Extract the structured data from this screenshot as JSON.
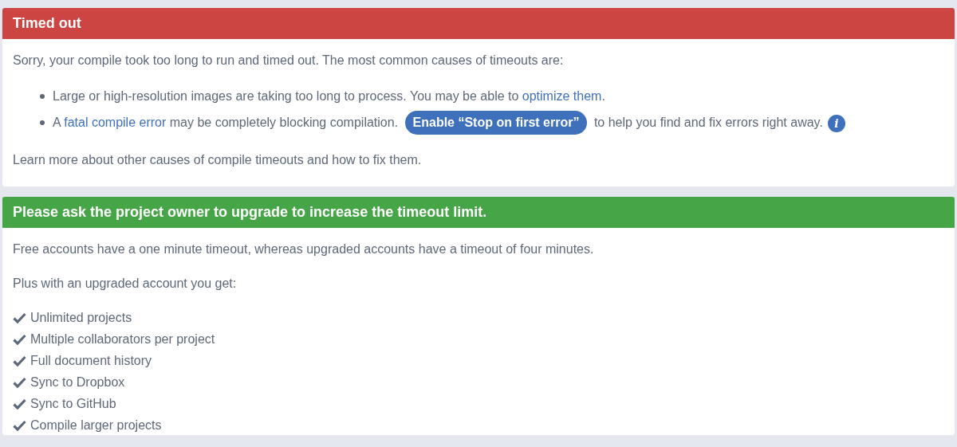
{
  "alerts": [
    {
      "kind": "error",
      "title": "Timed out",
      "blocks": [
        {
          "kind": "paragraph",
          "segments": [
            {
              "kind": "text",
              "text": "Sorry, your compile took too long to run and timed out. The most common causes of timeouts are:"
            }
          ]
        },
        {
          "kind": "bullets",
          "items": [
            {
              "segments": [
                {
                  "kind": "text",
                  "text": "Large or high-resolution images are taking too long to process. You may be able to "
                },
                {
                  "kind": "link",
                  "text": "optimize them"
                },
                {
                  "kind": "text",
                  "text": "."
                }
              ]
            },
            {
              "segments": [
                {
                  "kind": "text",
                  "text": "A "
                },
                {
                  "kind": "link",
                  "text": "fatal compile error"
                },
                {
                  "kind": "text",
                  "text": " may be completely blocking compilation. "
                },
                {
                  "kind": "button",
                  "text": "Enable “Stop on first error”"
                },
                {
                  "kind": "text",
                  "text": " to help you find and fix errors right away."
                },
                {
                  "kind": "info",
                  "text": "i"
                }
              ]
            }
          ]
        },
        {
          "kind": "paragraph",
          "segments": [
            {
              "kind": "text",
              "text": "Learn more about other causes of compile timeouts and how to fix them."
            }
          ]
        }
      ]
    },
    {
      "kind": "success",
      "title": "Please ask the project owner to upgrade to increase the timeout limit.",
      "blocks": [
        {
          "kind": "paragraph",
          "segments": [
            {
              "kind": "text",
              "text": "Free accounts have a one minute timeout, whereas upgraded accounts have a timeout of four minutes."
            }
          ]
        },
        {
          "kind": "paragraph",
          "segments": [
            {
              "kind": "text",
              "text": "Plus with an upgraded account you get:"
            }
          ]
        },
        {
          "kind": "checks",
          "items": [
            "Unlimited projects",
            "Multiple collaborators per project",
            "Full document history",
            "Sync to Dropbox",
            "Sync to GitHub",
            "Compile larger projects"
          ]
        }
      ]
    }
  ]
}
